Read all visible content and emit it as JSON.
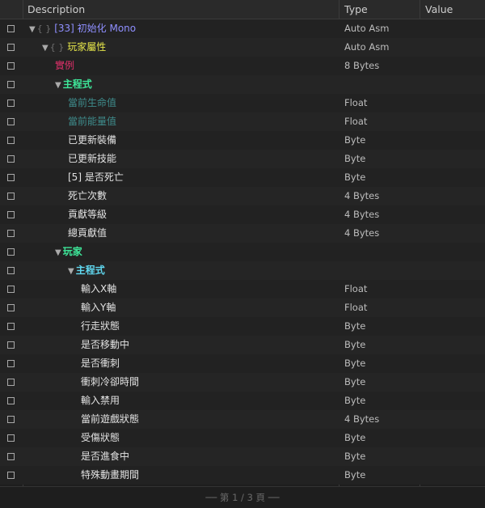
{
  "header": {
    "description": "Description",
    "type": "Type",
    "value": "Value"
  },
  "rows": [
    {
      "level": 0,
      "expand": true,
      "braces": true,
      "label": "[33] 初始化 Mono",
      "color": "#8f8fff",
      "bold": false,
      "type": "Auto Asm",
      "value": ""
    },
    {
      "level": 1,
      "expand": true,
      "braces": true,
      "label": "玩家屬性",
      "color": "#e6e64a",
      "bold": false,
      "type": "Auto Asm",
      "value": ""
    },
    {
      "level": 2,
      "expand": false,
      "braces": false,
      "label": "實例",
      "color": "#e0306a",
      "bold": false,
      "type": "8 Bytes",
      "value": ""
    },
    {
      "level": 2,
      "expand": true,
      "braces": false,
      "label": "主程式",
      "color": "#3ee89a",
      "bold": true,
      "type": "",
      "value": ""
    },
    {
      "level": 3,
      "expand": false,
      "braces": false,
      "label": "當前生命值",
      "color": "#3e8c8c",
      "bold": false,
      "type": "Float",
      "value": ""
    },
    {
      "level": 3,
      "expand": false,
      "braces": false,
      "label": "當前能量值",
      "color": "#3e8c8c",
      "bold": false,
      "type": "Float",
      "value": ""
    },
    {
      "level": 3,
      "expand": false,
      "braces": false,
      "label": "已更新裝備",
      "color": "#e2e2e2",
      "bold": false,
      "type": "Byte",
      "value": ""
    },
    {
      "level": 3,
      "expand": false,
      "braces": false,
      "label": "已更新技能",
      "color": "#e2e2e2",
      "bold": false,
      "type": "Byte",
      "value": ""
    },
    {
      "level": 3,
      "expand": false,
      "braces": false,
      "label": "[5] 是否死亡",
      "color": "#e2e2e2",
      "bold": false,
      "type": "Byte",
      "value": ""
    },
    {
      "level": 3,
      "expand": false,
      "braces": false,
      "label": "死亡次數",
      "color": "#e2e2e2",
      "bold": false,
      "type": "4 Bytes",
      "value": ""
    },
    {
      "level": 3,
      "expand": false,
      "braces": false,
      "label": "貢獻等級",
      "color": "#e2e2e2",
      "bold": false,
      "type": "4 Bytes",
      "value": ""
    },
    {
      "level": 3,
      "expand": false,
      "braces": false,
      "label": "總貢獻值",
      "color": "#e2e2e2",
      "bold": false,
      "type": "4 Bytes",
      "value": ""
    },
    {
      "level": 2,
      "expand": true,
      "braces": false,
      "label": "玩家",
      "color": "#3ee89a",
      "bold": true,
      "type": "",
      "value": ""
    },
    {
      "level": 3,
      "expand": true,
      "braces": false,
      "label": "主程式",
      "color": "#60d8f0",
      "bold": true,
      "type": "",
      "value": ""
    },
    {
      "level": 4,
      "expand": false,
      "braces": false,
      "label": "輸入X軸",
      "color": "#e2e2e2",
      "bold": false,
      "type": "Float",
      "value": ""
    },
    {
      "level": 4,
      "expand": false,
      "braces": false,
      "label": "輸入Y軸",
      "color": "#e2e2e2",
      "bold": false,
      "type": "Float",
      "value": ""
    },
    {
      "level": 4,
      "expand": false,
      "braces": false,
      "label": "行走狀態",
      "color": "#e2e2e2",
      "bold": false,
      "type": "Byte",
      "value": ""
    },
    {
      "level": 4,
      "expand": false,
      "braces": false,
      "label": "是否移動中",
      "color": "#e2e2e2",
      "bold": false,
      "type": "Byte",
      "value": ""
    },
    {
      "level": 4,
      "expand": false,
      "braces": false,
      "label": "是否衝刺",
      "color": "#e2e2e2",
      "bold": false,
      "type": "Byte",
      "value": ""
    },
    {
      "level": 4,
      "expand": false,
      "braces": false,
      "label": "衝刺冷卻時間",
      "color": "#e2e2e2",
      "bold": false,
      "type": "Byte",
      "value": ""
    },
    {
      "level": 4,
      "expand": false,
      "braces": false,
      "label": "輸入禁用",
      "color": "#e2e2e2",
      "bold": false,
      "type": "Byte",
      "value": ""
    },
    {
      "level": 4,
      "expand": false,
      "braces": false,
      "label": "當前遊戲狀態",
      "color": "#e2e2e2",
      "bold": false,
      "type": "4 Bytes",
      "value": ""
    },
    {
      "level": 4,
      "expand": false,
      "braces": false,
      "label": "受傷狀態",
      "color": "#e2e2e2",
      "bold": false,
      "type": "Byte",
      "value": ""
    },
    {
      "level": 4,
      "expand": false,
      "braces": false,
      "label": "是否進食中",
      "color": "#e2e2e2",
      "bold": false,
      "type": "Byte",
      "value": ""
    },
    {
      "level": 4,
      "expand": false,
      "braces": false,
      "label": "特殊動畫期間",
      "color": "#e2e2e2",
      "bold": false,
      "type": "Byte",
      "value": ""
    }
  ],
  "icons": {
    "expand": "▼",
    "braces": "{ }"
  },
  "footer": {
    "page": "── 第 1 / 3 頁 ──"
  }
}
